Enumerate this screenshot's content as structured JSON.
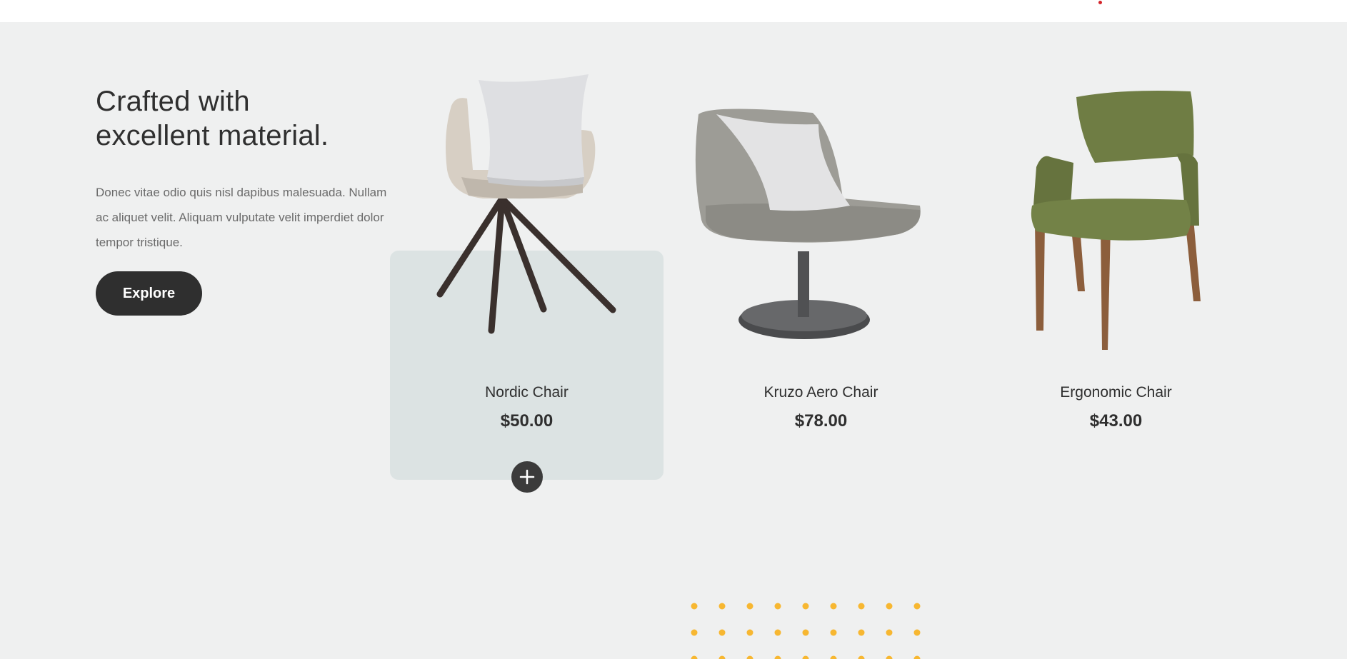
{
  "colors": {
    "background": "#eff0f0",
    "dark": "#2f2f2f",
    "card_highlight": "#dce3e3",
    "accent_dots": "#f7b731"
  },
  "intro": {
    "heading_line1": "Crafted with",
    "heading_line2": "excellent material.",
    "body": "Donec vitae odio quis nisl dapibus malesuada. Nullam ac aliquet velit. Aliquam vulputate velit imperdiet dolor tempor tristique.",
    "explore_label": "Explore"
  },
  "products": [
    {
      "name": "Nordic Chair",
      "price": "$50.00",
      "icon": "plus-icon"
    },
    {
      "name": "Kruzo Aero Chair",
      "price": "$78.00"
    },
    {
      "name": "Ergonomic Chair",
      "price": "$43.00"
    }
  ]
}
